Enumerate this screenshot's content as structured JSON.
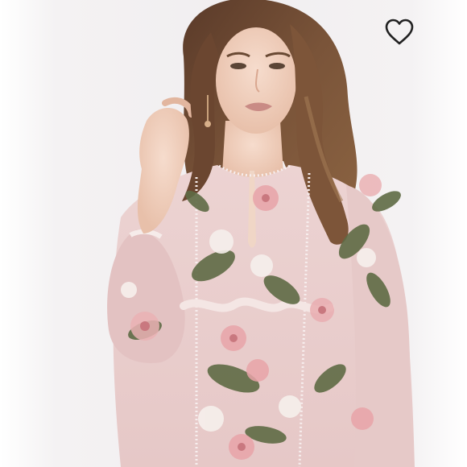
{
  "product_image": {
    "colors": {
      "backdrop": "#f2eff0",
      "dress": "#e9cfcf",
      "hair": "#6e4a34",
      "skin": "#f0d2c0",
      "leaf": "#5f6b45",
      "flower": "#e7a3a8"
    }
  },
  "favorite": {
    "icon": "heart-outline-icon",
    "stroke_color": "#222222"
  }
}
